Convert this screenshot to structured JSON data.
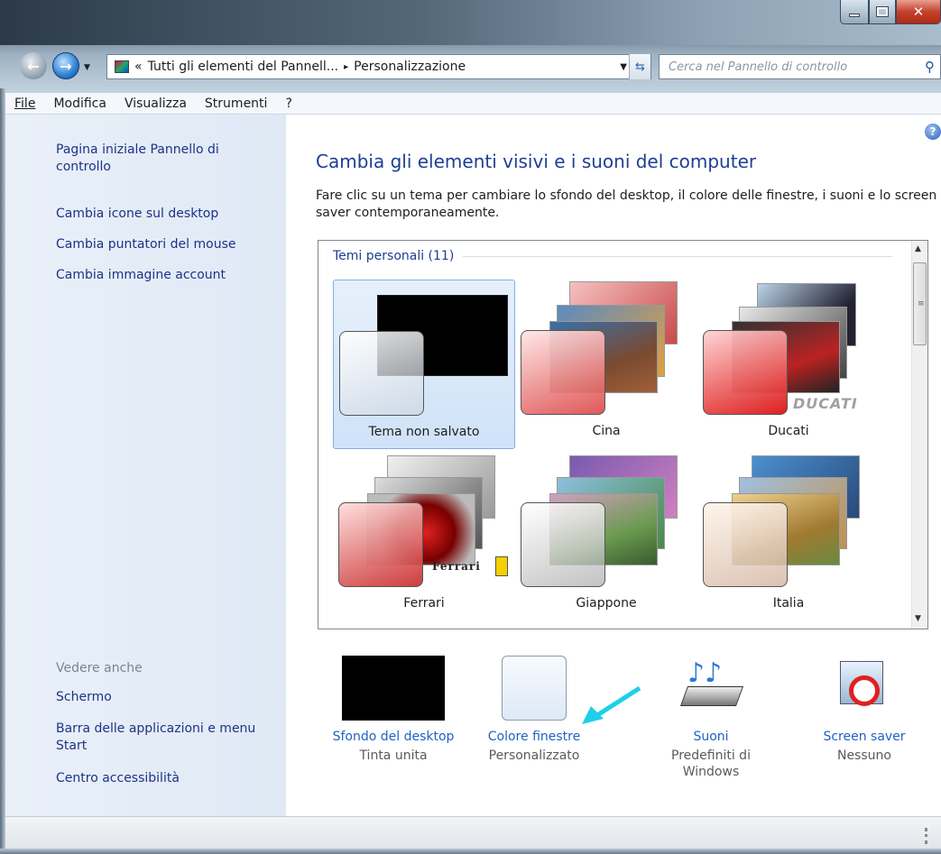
{
  "window": {
    "address_chevron": "«",
    "address_crumb1": "Tutti gli elementi del Pannell...",
    "address_arrow": "▸",
    "address_crumb2": "Personalizzazione",
    "search_placeholder": "Cerca nel Pannello di controllo"
  },
  "menu": [
    "File",
    "Modifica",
    "Visualizza",
    "Strumenti",
    "?"
  ],
  "sidebar": {
    "links": [
      "Pagina iniziale Pannello di controllo",
      "Cambia icone sul desktop",
      "Cambia puntatori del mouse",
      "Cambia immagine account"
    ],
    "see_also_title": "Vedere anche",
    "see_also": [
      "Schermo",
      "Barra delle applicazioni e menu Start",
      "Centro accessibilità"
    ]
  },
  "main": {
    "heading": "Cambia gli elementi visivi e i suoni del computer",
    "description": "Fare clic su un tema per cambiare lo sfondo del desktop, il colore delle finestre, i suoni e lo screen saver contemporaneamente.",
    "group_label": "Temi personali (11)",
    "themes": [
      {
        "name": "Tema non salvato",
        "selected": true
      },
      {
        "name": "Cina"
      },
      {
        "name": "Ducati",
        "brand": "DUCATI"
      },
      {
        "name": "Ferrari",
        "brand": "Ferrari"
      },
      {
        "name": "Giappone"
      },
      {
        "name": "Italia"
      }
    ],
    "bottom": [
      {
        "link": "Sfondo del desktop",
        "sub": "Tinta unita"
      },
      {
        "link": "Colore finestre",
        "sub": "Personalizzato"
      },
      {
        "link": "Suoni",
        "sub": "Predefiniti di Windows"
      },
      {
        "link": "Screen saver",
        "sub": "Nessuno"
      }
    ]
  },
  "colors": {
    "link": "#1e62c4",
    "heading": "#1e3e96",
    "accent_arrow": "#1ecfe8"
  }
}
